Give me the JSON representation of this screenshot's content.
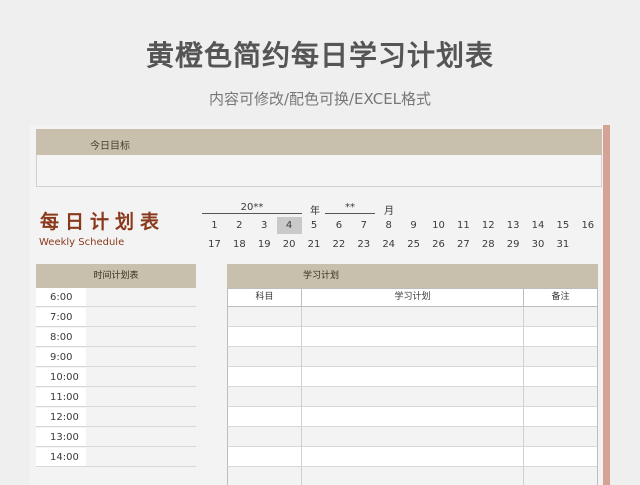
{
  "header": {
    "title": "黄橙色简约每日学习计划表",
    "subtitle": "内容可修改/配色可换/EXCEL格式"
  },
  "goal": {
    "label": "今日目标"
  },
  "daily": {
    "title": "每日计划表",
    "subtitle": "Weekly Schedule"
  },
  "date": {
    "year_value": "20**",
    "year_unit": "年",
    "month_value": "**",
    "month_unit": "月",
    "days_row1": [
      "1",
      "2",
      "3",
      "4",
      "5",
      "6",
      "7",
      "8",
      "9",
      "10",
      "11",
      "12",
      "13",
      "14",
      "15",
      "16"
    ],
    "days_row2": [
      "17",
      "18",
      "19",
      "20",
      "21",
      "22",
      "23",
      "24",
      "25",
      "26",
      "27",
      "28",
      "29",
      "30",
      "31"
    ],
    "selected_day": "4"
  },
  "time_plan": {
    "title": "时间计划表",
    "times": [
      "6:00",
      "7:00",
      "8:00",
      "9:00",
      "10:00",
      "11:00",
      "12:00",
      "13:00",
      "14:00"
    ]
  },
  "study_plan": {
    "title": "学习计划",
    "columns": [
      "科目",
      "学习计划",
      "备注"
    ]
  },
  "colors": {
    "header_band": "#c8bfac",
    "title_accent": "#8a3a1c",
    "side_bar": "#d4a395"
  }
}
